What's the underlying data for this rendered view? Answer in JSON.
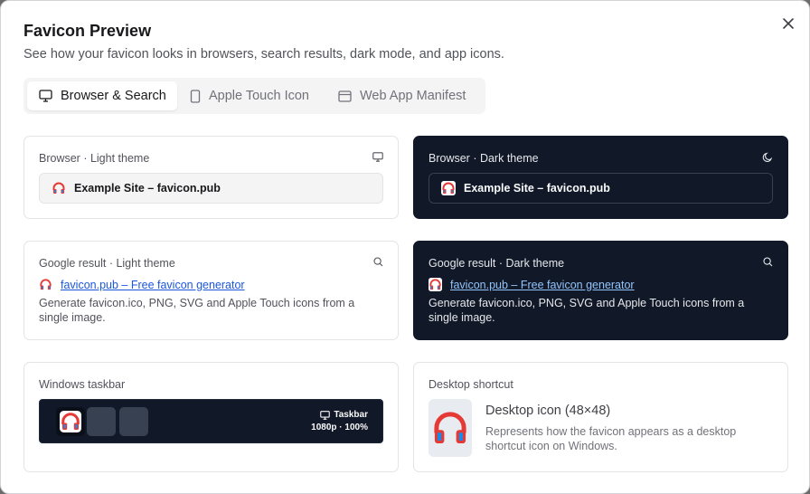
{
  "dialog": {
    "title": "Favicon Preview",
    "subtitle": "See how your favicon looks in browsers, search results, dark mode, and app icons."
  },
  "tabs": [
    {
      "label": "Browser & Search",
      "icon": "monitor-icon",
      "active": true
    },
    {
      "label": "Apple Touch Icon",
      "icon": "phone-icon",
      "active": false
    },
    {
      "label": "Web App Manifest",
      "icon": "browser-window-icon",
      "active": false
    }
  ],
  "browser_light": {
    "label": "Browser · Light theme",
    "tab_title": "Example Site – favicon.pub",
    "icon": "monitor-icon"
  },
  "browser_dark": {
    "label": "Browser · Dark theme",
    "tab_title": "Example Site – favicon.pub",
    "icon": "moon-icon"
  },
  "google_light": {
    "label": "Google result · Light theme",
    "link": "favicon.pub – Free favicon generator",
    "description": "Generate favicon.ico, PNG, SVG and Apple Touch icons from a single image.",
    "icon": "search-icon"
  },
  "google_dark": {
    "label": "Google result · Dark theme",
    "link": "favicon.pub – Free favicon generator",
    "description": "Generate favicon.ico, PNG, SVG and Apple Touch icons from a single image.",
    "icon": "search-icon"
  },
  "taskbar": {
    "label": "Windows taskbar",
    "info_title": "Taskbar",
    "info_sub": "1080p · 100%"
  },
  "desktop": {
    "label": "Desktop shortcut",
    "title": "Desktop icon (48×48)",
    "description": "Represents how the favicon appears as a desktop shortcut icon on Windows."
  },
  "colors": {
    "dark_card": "#111827",
    "link": "#1a56db",
    "link_dark": "#93c5fd",
    "accent_red": "#e53935",
    "accent_blue": "#1e88e5"
  }
}
